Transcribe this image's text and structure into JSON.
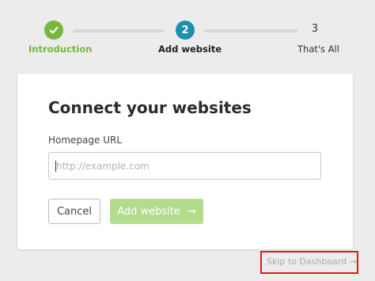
{
  "stepper": {
    "steps": [
      {
        "number": "1",
        "label": "Introduction",
        "state": "completed",
        "color": "#79b73b"
      },
      {
        "number": "2",
        "label": "Add website",
        "state": "active",
        "color": "#1e8fb0"
      },
      {
        "number": "3",
        "label": "That's All",
        "state": "upcoming"
      }
    ],
    "check_icon": "check-icon"
  },
  "card": {
    "title": "Connect your websites",
    "homepage_label": "Homepage URL",
    "homepage_placeholder": "http://example.com",
    "homepage_value": "",
    "cancel_label": "Cancel",
    "add_label": "Add website",
    "add_arrow": "→",
    "add_button_color": "#b3dc8c"
  },
  "footer": {
    "skip_label": "Skip to Dashboard",
    "skip_arrow": "→",
    "highlight_color": "#e11a1a"
  }
}
